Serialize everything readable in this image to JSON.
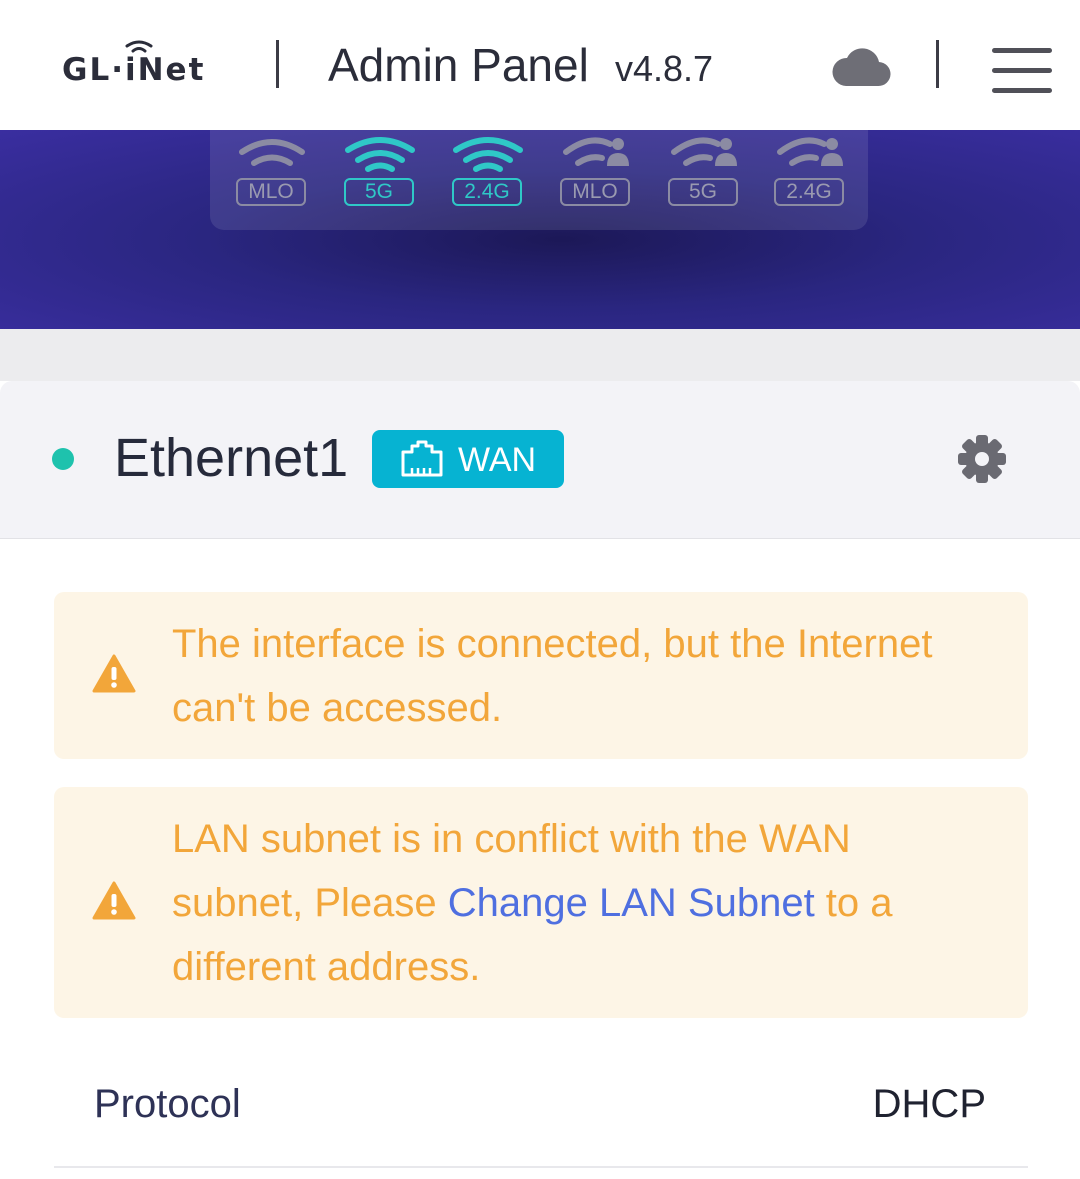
{
  "header": {
    "logo": "GL·iNet",
    "title": "Admin Panel",
    "version": "v4.8.7",
    "icons": [
      "cloud-icon",
      "menu-icon"
    ]
  },
  "wifi_bands": [
    {
      "label": "MLO",
      "active": false,
      "type": "main"
    },
    {
      "label": "5G",
      "active": true,
      "type": "main"
    },
    {
      "label": "2.4G",
      "active": true,
      "type": "main"
    },
    {
      "label": "MLO",
      "active": false,
      "type": "guest"
    },
    {
      "label": "5G",
      "active": false,
      "type": "guest"
    },
    {
      "label": "2.4G",
      "active": false,
      "type": "guest"
    }
  ],
  "interface": {
    "name": "Ethernet1",
    "badge": "WAN",
    "status_color": "#1ec2ad"
  },
  "alerts": [
    {
      "text": "The interface is connected, but the Internet can't be accessed."
    },
    {
      "text_before": "LAN subnet is in conflict with the WAN subnet, Please ",
      "link": "Change LAN Subnet",
      "text_after": " to a different address."
    }
  ],
  "details": [
    {
      "label": "Protocol",
      "value": "DHCP"
    }
  ],
  "colors": {
    "accent": "#06b3d2",
    "wifi_active": "#2fc8c7",
    "warning": "#f2a63a",
    "link": "#4f6fe0",
    "banner": "#2a2680"
  }
}
